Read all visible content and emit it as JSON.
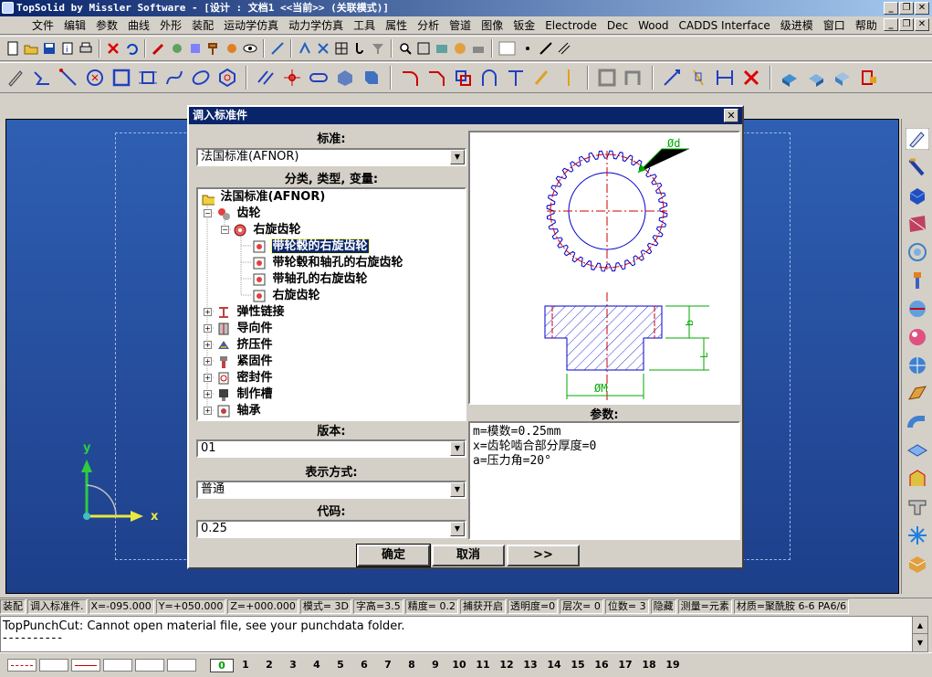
{
  "window": {
    "title": "TopSolid by Missler Software - [设计 : 文档1  <<当前>> (关联模式)]",
    "min_label": "_",
    "max_label": "❐",
    "close_label": "✕"
  },
  "menubar": {
    "items": [
      "文件",
      "编辑",
      "参数",
      "曲线",
      "外形",
      "装配",
      "运动学仿真",
      "动力学仿真",
      "工具",
      "属性",
      "分析",
      "管道",
      "图像",
      "钣金",
      "Electrode",
      "Dec",
      "Wood",
      "CADDS Interface",
      "级进模",
      "窗口",
      "帮助"
    ]
  },
  "dialog": {
    "title": "调入标准件",
    "close_label": "✕",
    "standard_label": "标准:",
    "standard_value": "法国标准(AFNOR)",
    "category_label": "分类, 类型, 变量:",
    "tree": {
      "root": "法国标准(AFNOR)",
      "gear": "齿轮",
      "right_gear": "右旋齿轮",
      "leaf1": "带轮毂的右旋齿轮",
      "leaf2": "带轮毂和轴孔的右旋齿轮",
      "leaf3": "带轴孔的右旋齿轮",
      "leaf4": "右旋齿轮",
      "cat1": "弹性链接",
      "cat2": "导向件",
      "cat3": "挤压件",
      "cat4": "紧固件",
      "cat5": "密封件",
      "cat6": "制作槽",
      "cat7": "轴承"
    },
    "preview": {
      "dim_d": "Ød",
      "dim_m": "ØM",
      "dim_b": "b",
      "dim_l": "L"
    },
    "version_label": "版本:",
    "version_value": "01",
    "display_label": "表示方式:",
    "display_value": "普通",
    "code_label": "代码:",
    "code_value": "0.25",
    "params_label": "参数:",
    "params": [
      "m=模数=0.25mm",
      "x=齿轮啮合部分厚度=0",
      "a=压力角=20°"
    ],
    "ok_label": "确定",
    "cancel_label": "取消",
    "more_label": ">>"
  },
  "axes": {
    "x": "x",
    "y": "y"
  },
  "statusbar": {
    "cells": [
      "装配",
      "调入标准件.",
      "X=-095.000",
      "Y=+050.000",
      "Z=+000.000",
      "模式= 3D",
      "字高=3.5",
      "精度=  0.2",
      "捕获开启",
      "透明度=0",
      "层次=  0",
      "位数= 3",
      "隐藏",
      "测量=元素",
      "材质=聚酰胺 6-6 PA6/6"
    ]
  },
  "message": {
    "text": "TopPunchCut: Cannot open material file, see your punchdata folder.",
    "dashes": "----------"
  },
  "layers": [
    "0",
    "1",
    "2",
    "3",
    "4",
    "5",
    "6",
    "7",
    "8",
    "9",
    "10",
    "11",
    "12",
    "13",
    "14",
    "15",
    "16",
    "17",
    "18",
    "19"
  ],
  "colors": {
    "titlebar": "#0a246a",
    "canvas": "#2f5fb3",
    "selection": "#0a246a",
    "drawing_blue": "#0000cc",
    "drawing_red": "#cc0000",
    "drawing_green": "#00aa00"
  }
}
